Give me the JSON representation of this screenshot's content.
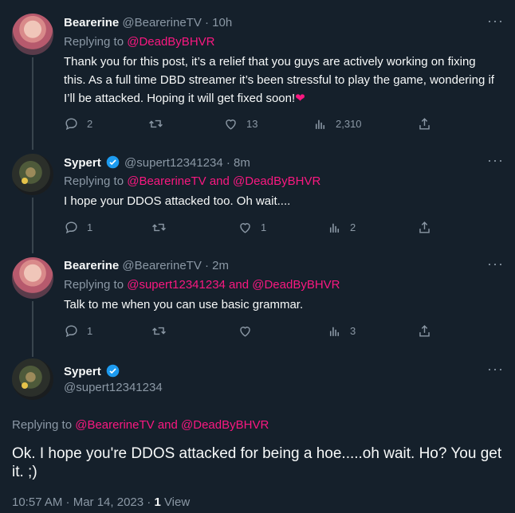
{
  "tweets": [
    {
      "name": "Bearerine",
      "handle": "@BearerineTV",
      "time": "· 10h",
      "replying_prefix": "Replying to ",
      "mentions": "@DeadByBHVR",
      "text": "Thank you for this post, it’s a relief that you guys are actively working on fixing this. As a full time DBD streamer it’s been stressful to play the game, wondering if I’ll be attacked. Hoping it will get fixed soon!",
      "emoji": "❤",
      "replies": "2",
      "retweets": "",
      "likes": "13",
      "views": "2,310"
    },
    {
      "name": "Sypert",
      "handle": "@supert12341234",
      "time": "· 8m",
      "replying_prefix": "Replying to ",
      "mentions": "@BearerineTV and @DeadByBHVR",
      "text": "I hope your DDOS attacked too. Oh wait....",
      "replies": "1",
      "retweets": "",
      "likes": "1",
      "views": "2"
    },
    {
      "name": "Bearerine",
      "handle": "@BearerineTV",
      "time": "· 2m",
      "replying_prefix": "Replying to ",
      "mentions": "@supert12341234 and @DeadByBHVR",
      "text": "Talk to me when you can use basic grammar.",
      "replies": "1",
      "retweets": "",
      "likes": "",
      "views": "3"
    }
  ],
  "main_tweet": {
    "name": "Sypert",
    "handle": "@supert12341234",
    "replying_prefix": "Replying to ",
    "mentions": "@BearerineTV and @DeadByBHVR",
    "text": "Ok. I hope you're DDOS attacked for being a hoe.....oh wait. Ho? You get it. ;)",
    "timestamp": "10:57 AM · Mar 14, 2023 · ",
    "view_count": "1",
    "view_label": " View"
  },
  "more_glyph": "···",
  "colors": {
    "background": "#15202b",
    "mention": "#f91880",
    "muted": "#8b98a5",
    "verified": "#1d9bf0"
  },
  "icons": [
    "reply-icon",
    "retweet-icon",
    "like-icon",
    "views-icon",
    "share-icon",
    "verified-icon",
    "more-icon"
  ]
}
